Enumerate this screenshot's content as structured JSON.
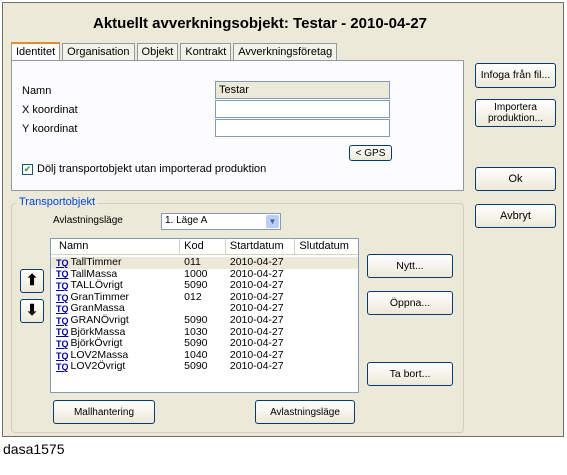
{
  "window": {
    "title": "Aktuellt avverkningsobjekt: Testar - 2010-04-27"
  },
  "tabs": [
    {
      "label": "Identitet",
      "active": true
    },
    {
      "label": "Organisation"
    },
    {
      "label": "Objekt"
    },
    {
      "label": "Kontrakt"
    },
    {
      "label": "Avverkningsföretag"
    }
  ],
  "identity": {
    "name_label": "Namn",
    "name_value": "Testar",
    "x_label": "X koordinat",
    "x_value": "",
    "y_label": "Y koordinat",
    "y_value": "",
    "gps_button": "< GPS",
    "hide_checkbox_label": "Dölj transportobjekt utan importerad produktion",
    "hide_checkbox_checked": true
  },
  "side_buttons": {
    "infoga": "Infoga från fil...",
    "importera": "Importera produktion...",
    "ok": "Ok",
    "avbryt": "Avbryt"
  },
  "transport": {
    "group_label": "Transportobjekt",
    "avlastning_label": "Avlastningsläge",
    "avlastning_value": "1. Läge A",
    "columns": {
      "name": "Namn",
      "kod": "Kod",
      "start": "Startdatum",
      "slut": "Slutdatum"
    },
    "rows": [
      {
        "icon": "TQ",
        "name": "TallTimmer",
        "kod": "011",
        "start": "2010-04-27",
        "slut": ""
      },
      {
        "icon": "TQ",
        "name": "TallMassa",
        "kod": "1000",
        "start": "2010-04-27",
        "slut": ""
      },
      {
        "icon": "TQ",
        "name": "TALLÖvrigt",
        "kod": "5090",
        "start": "2010-04-27",
        "slut": ""
      },
      {
        "icon": "TQ",
        "name": "GranTimmer",
        "kod": "012",
        "start": "2010-04-27",
        "slut": ""
      },
      {
        "icon": "TQ",
        "name": "GranMassa",
        "kod": "",
        "start": "2010-04-27",
        "slut": ""
      },
      {
        "icon": "TQ",
        "name": "GRANÖvrigt",
        "kod": "5090",
        "start": "2010-04-27",
        "slut": ""
      },
      {
        "icon": "TQ",
        "name": "BjörkMassa",
        "kod": "1030",
        "start": "2010-04-27",
        "slut": ""
      },
      {
        "icon": "TQ",
        "name": "BjörkÖvrigt",
        "kod": "5090",
        "start": "2010-04-27",
        "slut": ""
      },
      {
        "icon": "TQ",
        "name": "LOV2Massa",
        "kod": "1040",
        "start": "2010-04-27",
        "slut": ""
      },
      {
        "icon": "TQ",
        "name": "LOV2Övrigt",
        "kod": "5090",
        "start": "2010-04-27",
        "slut": ""
      }
    ],
    "buttons": {
      "nytt": "Nytt...",
      "oppna": "Öppna...",
      "ta_bort": "Ta bort...",
      "mallhantering": "Mallhantering",
      "avlastningslage": "Avlastningsläge"
    }
  },
  "footer_text": "dasa1575"
}
